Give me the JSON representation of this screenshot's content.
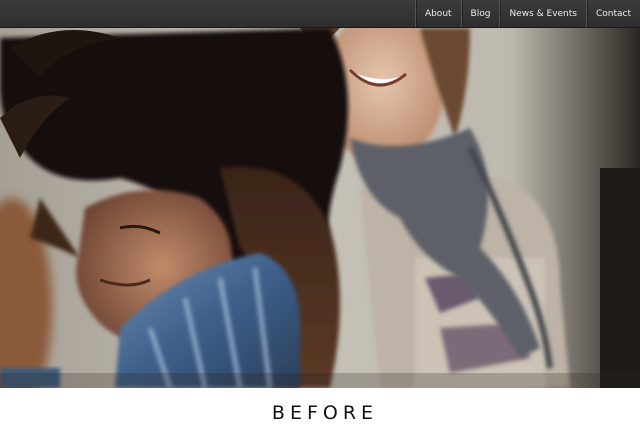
{
  "nav": {
    "items": [
      {
        "label": "About"
      },
      {
        "label": "Blog"
      },
      {
        "label": "News & Events"
      },
      {
        "label": "Contact"
      }
    ]
  },
  "hero": {
    "caption": "BEFORE"
  }
}
